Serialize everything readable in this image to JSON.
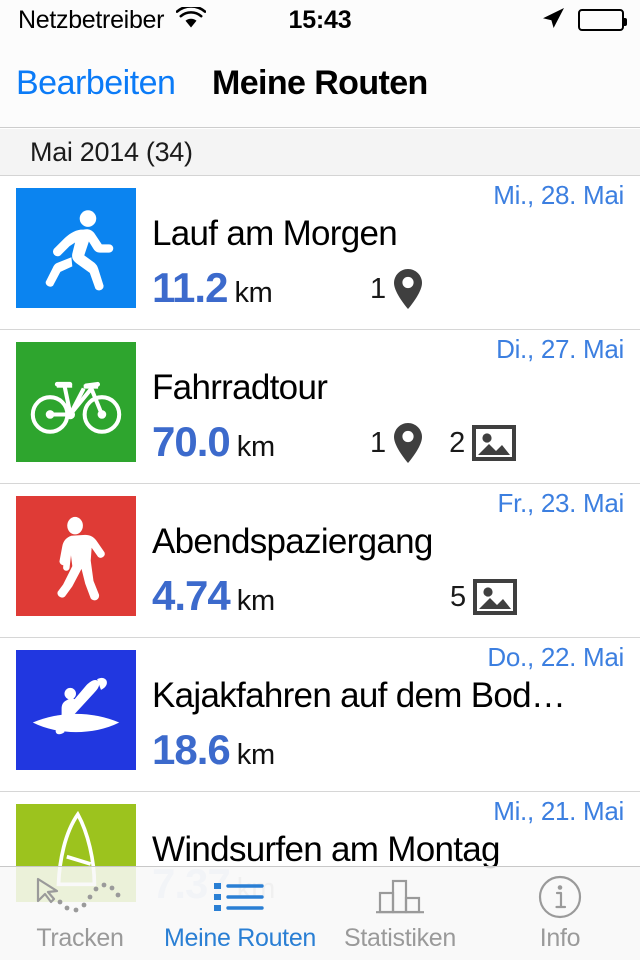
{
  "status_bar": {
    "carrier": "Netzbetreiber",
    "wifi_icon": "wifi-icon",
    "time": "15:43",
    "location_icon": "location-arrow-icon",
    "battery_icon": "battery-full-icon"
  },
  "nav_bar": {
    "edit_label": "Bearbeiten",
    "title": "Meine Routen"
  },
  "section": {
    "header": "Mai 2014 (34)"
  },
  "colors": {
    "accent_blue": "#0b7bf7",
    "date_blue": "#3c7fe0",
    "distance_blue": "#3c6acc",
    "run_tile": "#0b84f0",
    "bike_tile": "#2ea52e",
    "walk_tile": "#df3b36",
    "kayak_tile": "#2137e0",
    "windsurf_tile": "#9cc31e"
  },
  "routes": [
    {
      "icon": "running-icon",
      "tile_color": "#0b84f0",
      "title": "Lauf am Morgen",
      "distance": "11.2",
      "unit": "km",
      "date": "Mi., 28. Mai",
      "waypoints": "1",
      "photos": null
    },
    {
      "icon": "bicycle-icon",
      "tile_color": "#2ea52e",
      "title": "Fahrradtour",
      "distance": "70.0",
      "unit": "km",
      "date": "Di., 27. Mai",
      "waypoints": "1",
      "photos": "2"
    },
    {
      "icon": "walking-icon",
      "tile_color": "#df3b36",
      "title": "Abendspaziergang",
      "distance": "4.74",
      "unit": "km",
      "date": "Fr., 23. Mai",
      "waypoints": null,
      "photos": "5"
    },
    {
      "icon": "kayak-icon",
      "tile_color": "#2137e0",
      "title": "Kajakfahren auf dem Bod…",
      "distance": "18.6",
      "unit": "km",
      "date": "Do., 22. Mai",
      "waypoints": null,
      "photos": null
    },
    {
      "icon": "windsurfing-icon",
      "tile_color": "#9cc31e",
      "title": "Windsurfen am Montag",
      "distance": "7.37",
      "unit": "km",
      "date": "Mi., 21. Mai",
      "waypoints": null,
      "photos": null
    }
  ],
  "tab_bar": {
    "tabs": [
      {
        "icon": "track-cursor-icon",
        "label": "Tracken",
        "active": false
      },
      {
        "icon": "bulleted-list-icon",
        "label": "Meine Routen",
        "active": true
      },
      {
        "icon": "bar-chart-icon",
        "label": "Statistiken",
        "active": false
      },
      {
        "icon": "info-circle-icon",
        "label": "Info",
        "active": false
      }
    ]
  }
}
